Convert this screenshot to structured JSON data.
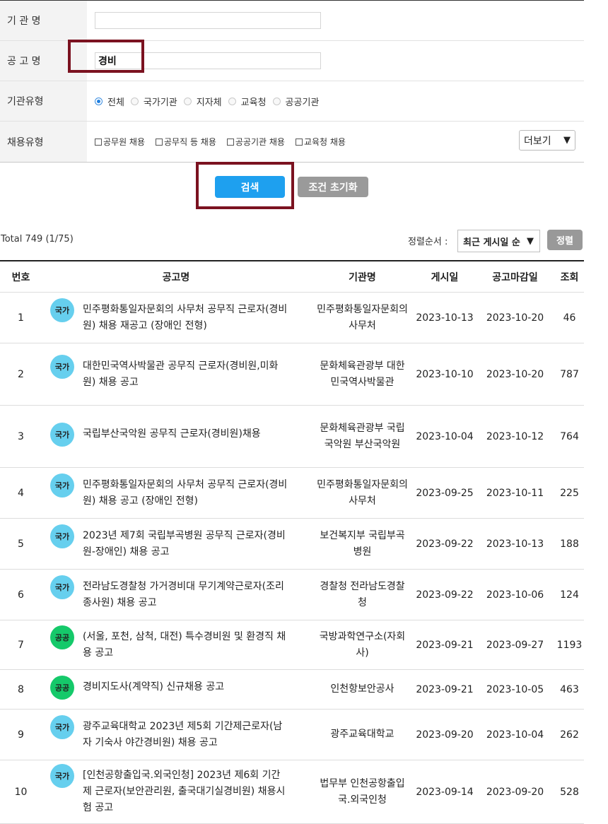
{
  "search": {
    "org_label": "기 관 명",
    "org_value": "",
    "title_label": "공 고 명",
    "title_value": "경비",
    "orgtype_label": "기관유형",
    "orgtypes": [
      {
        "label": "전체",
        "selected": true
      },
      {
        "label": "국가기관",
        "selected": false
      },
      {
        "label": "지자체",
        "selected": false
      },
      {
        "label": "교육청",
        "selected": false
      },
      {
        "label": "공공기관",
        "selected": false
      }
    ],
    "emptype_label": "채용유형",
    "emptypes": [
      "공무원 채용",
      "공무직 등 채용",
      "공공기관 채용",
      "교육청 채용"
    ],
    "more_label": "더보기",
    "search_button": "검색",
    "reset_button": "조건 초기화"
  },
  "list": {
    "total": "Total 749 (1/75)",
    "sort_label": "정렬순서 :",
    "sort_value": "최근 게시일 순",
    "sort_button": "정렬",
    "columns": [
      "번호",
      "공고명",
      "기관명",
      "게시일",
      "공고마감일",
      "조회"
    ],
    "rows": [
      {
        "no": "1",
        "badge": "국가",
        "title": "민주평화통일자문회의 사무처 공무직 근로자(경비원) 채용 재공고 (장애인 전형)",
        "org": "민주평화통일자문회의사무처",
        "posted": "2023-10-13",
        "deadline": "2023-10-20",
        "closed": false,
        "views": "46"
      },
      {
        "no": "2",
        "badge": "국가",
        "title": "대한민국역사박물관 공무직 근로자(경비원,미화원) 채용 공고",
        "org": "문화체육관광부 대한민국역사박물관",
        "posted": "2023-10-10",
        "deadline": "2023-10-20",
        "closed": false,
        "views": "787"
      },
      {
        "no": "3",
        "badge": "국가",
        "title": "국립부산국악원 공무직 근로자(경비원)채용",
        "org": "문화체육관광부 국립국악원 부산국악원",
        "posted": "2023-10-04",
        "deadline": "2023-10-12",
        "closed": true,
        "views": "764"
      },
      {
        "no": "4",
        "badge": "국가",
        "title": "민주평화통일자문회의 사무처 공무직 근로자(경비원) 채용 공고 (장애인 전형)",
        "org": "민주평화통일자문회의사무처",
        "posted": "2023-09-25",
        "deadline": "2023-10-11",
        "closed": true,
        "views": "225"
      },
      {
        "no": "5",
        "badge": "국가",
        "title": "2023년 제7회 국립부곡병원 공무직 근로자(경비원-장애인) 채용 공고",
        "org": "보건복지부 국립부곡병원",
        "posted": "2023-09-22",
        "deadline": "2023-10-13",
        "closed": false,
        "views": "188"
      },
      {
        "no": "6",
        "badge": "국가",
        "title": "전라남도경찰청 가거경비대 무기계약근로자(조리종사원) 채용 공고",
        "org": "경찰청 전라남도경찰청",
        "posted": "2023-09-22",
        "deadline": "2023-10-06",
        "closed": true,
        "views": "124"
      },
      {
        "no": "7",
        "badge": "공공",
        "title": "(서울, 포천, 삼척, 대전) 특수경비원 및 환경직 채용 공고",
        "org": "국방과학연구소(자회사)",
        "posted": "2023-09-21",
        "deadline": "2023-09-27",
        "closed": true,
        "views": "1193"
      },
      {
        "no": "8",
        "badge": "공공",
        "title": "경비지도사(계약직) 신규채용 공고",
        "org": "인천항보안공사",
        "posted": "2023-09-21",
        "deadline": "2023-10-05",
        "closed": true,
        "views": "463"
      },
      {
        "no": "9",
        "badge": "국가",
        "title": "광주교육대학교 2023년 제5회 기간제근로자(남자 기숙사 야간경비원) 채용 공고",
        "org": "광주교육대학교",
        "posted": "2023-09-20",
        "deadline": "2023-10-04",
        "closed": true,
        "views": "262"
      },
      {
        "no": "10",
        "badge": "국가",
        "title": "[인천공항출입국.외국인청] 2023년 제6회 기간제 근로자(보안관리원, 출국대기실경비원) 채용시험 공고",
        "org": "법무부 인천공항출입국.외국인청",
        "posted": "2023-09-14",
        "deadline": "2023-09-20",
        "closed": true,
        "views": "528"
      }
    ]
  },
  "colors": {
    "search_button": "#1ea0ef",
    "highlight_border": "#7b1220",
    "badge_national": "#66cfee",
    "badge_public": "#15c96a"
  }
}
